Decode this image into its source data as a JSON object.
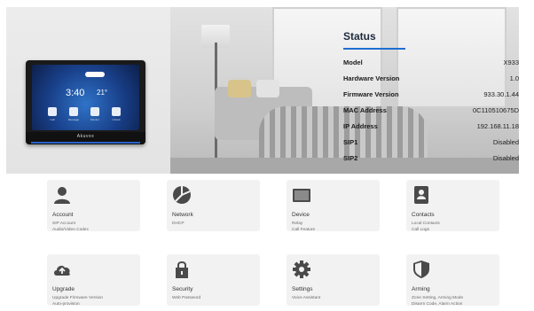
{
  "device": {
    "time": "3:40",
    "temp": "21°",
    "brand": "Akuvox",
    "buttons": [
      "Call",
      "Message",
      "Monitor",
      "Unlock"
    ]
  },
  "status": {
    "title": "Status",
    "rows": [
      {
        "label": "Model",
        "value": "X933"
      },
      {
        "label": "Hardware Version",
        "value": "1.0"
      },
      {
        "label": "Firmware Version",
        "value": "933.30.1.44"
      },
      {
        "label": "MAC Address",
        "value": "0C110510675D"
      },
      {
        "label": "IP Address",
        "value": "192.168.11.18"
      },
      {
        "label": "SIP1",
        "value": "Disabled"
      },
      {
        "label": "SIP2",
        "value": "Disabled"
      }
    ]
  },
  "tiles": [
    {
      "title": "Account",
      "lines": [
        "SIP Account",
        "Audio/Video Codec"
      ],
      "icon": "user-icon"
    },
    {
      "title": "Network",
      "lines": [
        "DHCP"
      ],
      "icon": "network-icon"
    },
    {
      "title": "Device",
      "lines": [
        "Relay",
        "Call Feature"
      ],
      "icon": "monitor-icon"
    },
    {
      "title": "Contacts",
      "lines": [
        "Local Contacts",
        "Call Logs"
      ],
      "icon": "contacts-icon"
    },
    {
      "title": "Upgrade",
      "lines": [
        "Upgrade Firmware Version",
        "Auto-provision"
      ],
      "icon": "cloud-upload-icon"
    },
    {
      "title": "Security",
      "lines": [
        "Web Password"
      ],
      "icon": "lock-icon"
    },
    {
      "title": "Settings",
      "lines": [
        "Voice Assistant"
      ],
      "icon": "gear-icon"
    },
    {
      "title": "Arming",
      "lines": [
        "Zone Setting, Arming Mode",
        "Disarm Code, Alarm Action"
      ],
      "icon": "shield-icon"
    }
  ],
  "colors": {
    "accent": "#1d6fd1",
    "tile_bg": "#f2f2f2",
    "icon": "#4a4a4a"
  }
}
